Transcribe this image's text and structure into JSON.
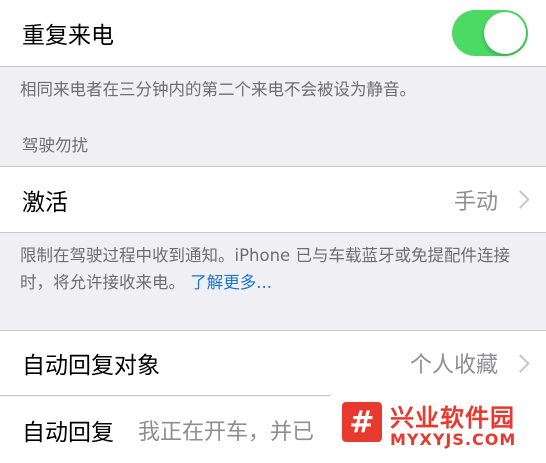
{
  "repeat_calls": {
    "label": "重复来电",
    "toggle_on": true
  },
  "repeat_calls_footer": "相同来电者在三分钟内的第二个来电不会被设为静音。",
  "driving_section": {
    "header": "驾驶勿扰",
    "activate": {
      "label": "激活",
      "value": "手动"
    },
    "footer_text": "限制在驾驶过程中收到通知。iPhone 已与车载蓝牙或免提配件连接时，将允许接收来电。",
    "footer_link": "了解更多..."
  },
  "auto_reply_to": {
    "label": "自动回复对象",
    "value": "个人收藏"
  },
  "auto_reply": {
    "label": "自动回复",
    "value": "我正在开车，并已"
  },
  "watermark": {
    "logo_glyph": "#",
    "title": "兴业软件园",
    "url": "MYXYJS.COM"
  },
  "colors": {
    "toggle_green": "#4cd964",
    "link_blue": "#1a76d2",
    "watermark_red": "#e8392f"
  }
}
